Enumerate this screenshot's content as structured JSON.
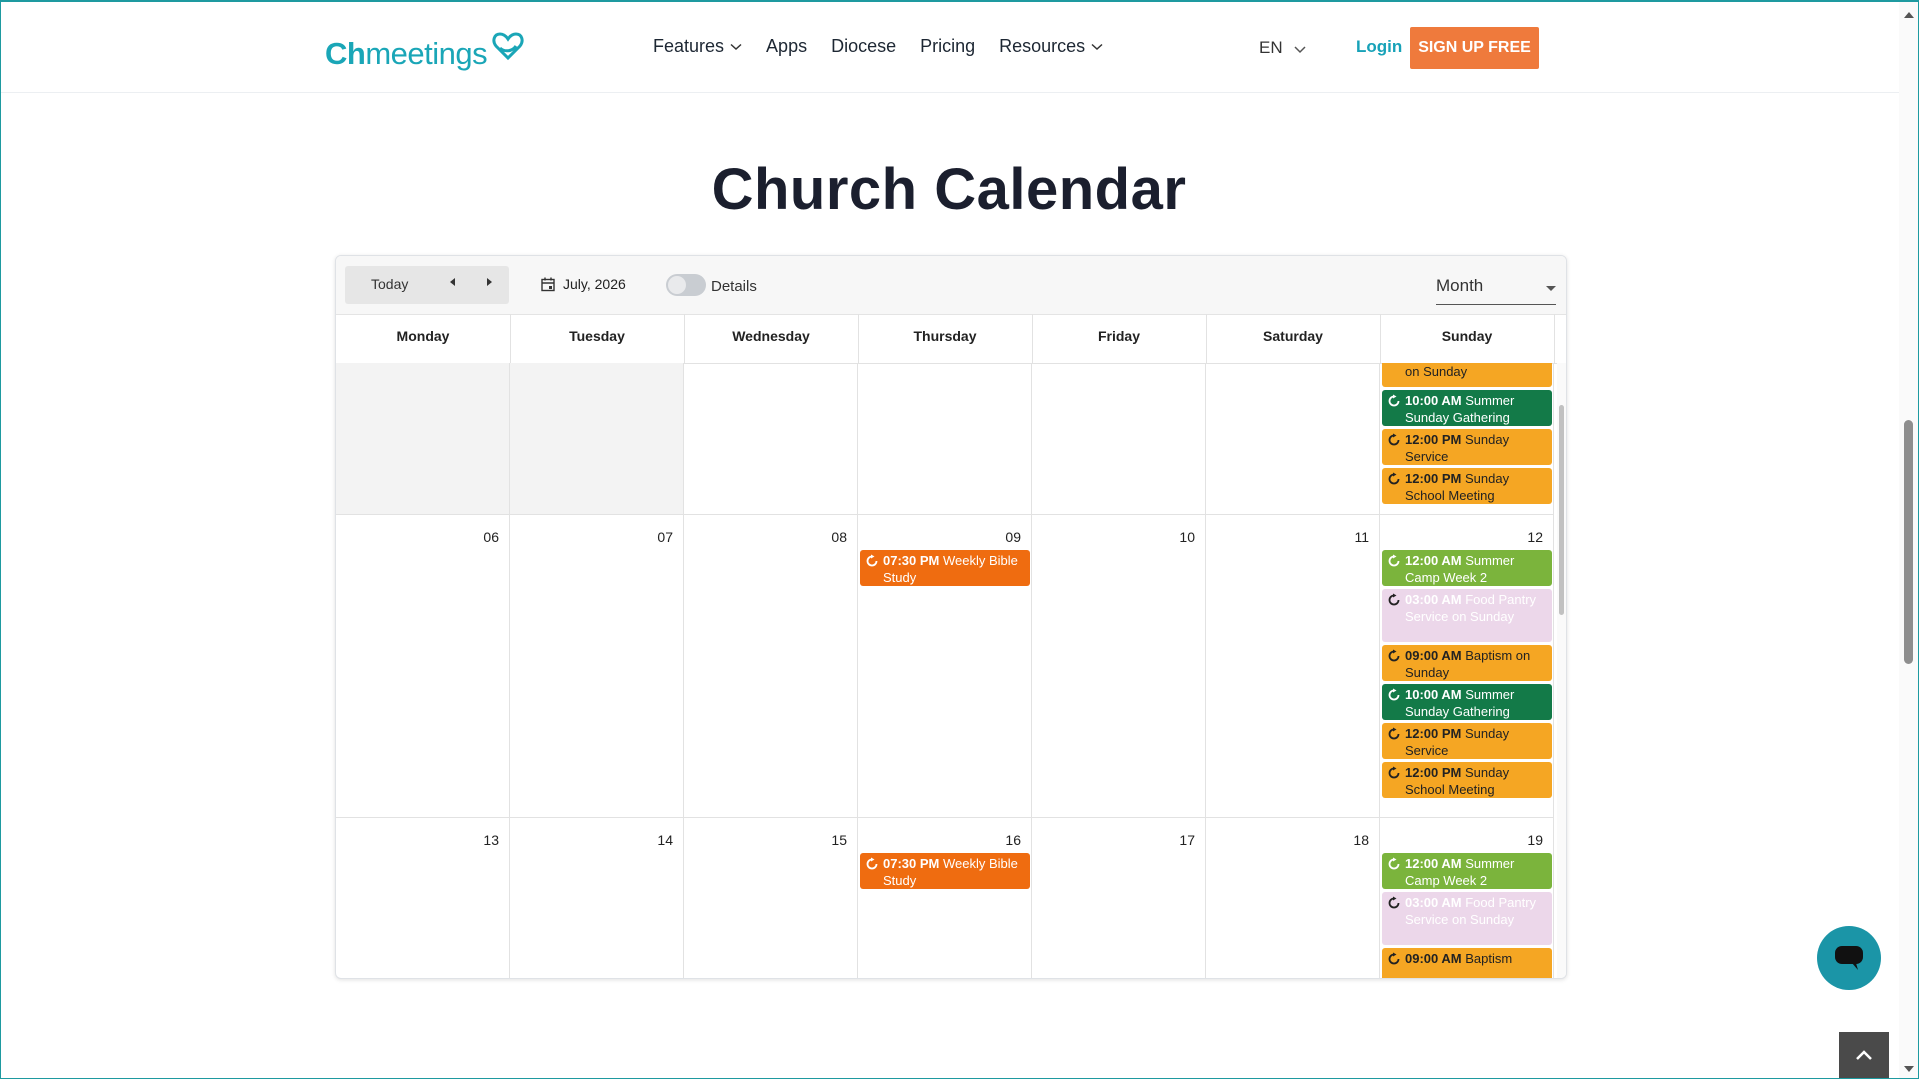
{
  "header": {
    "logo_bold": "Ch",
    "logo_rest": "meetings",
    "nav": [
      {
        "label": "Features",
        "dropdown": true
      },
      {
        "label": "Apps",
        "dropdown": false
      },
      {
        "label": "Diocese",
        "dropdown": false
      },
      {
        "label": "Pricing",
        "dropdown": false
      },
      {
        "label": "Resources",
        "dropdown": true
      }
    ],
    "language": "EN",
    "login_label": "Login",
    "signup_label": "SIGN UP FREE"
  },
  "page_title": "Church Calendar",
  "toolbar": {
    "today_label": "Today",
    "current_month": "July, 2026",
    "details_label": "Details",
    "details_enabled": false,
    "view_label": "Month"
  },
  "weekdays": [
    "Monday",
    "Tuesday",
    "Wednesday",
    "Thursday",
    "Friday",
    "Saturday",
    "Sunday"
  ],
  "weeks": [
    {
      "days": [
        {
          "date": "",
          "gray": true,
          "events": []
        },
        {
          "date": "",
          "gray": true,
          "events": []
        },
        {
          "date": "",
          "gray": false,
          "events": []
        },
        {
          "date": "",
          "gray": false,
          "events": []
        },
        {
          "date": "",
          "gray": false,
          "events": []
        },
        {
          "date": "",
          "gray": false,
          "events": []
        },
        {
          "date": "",
          "gray": false,
          "events": [
            {
              "time": "",
              "title": "on Sunday",
              "color": "orange",
              "partial": true
            },
            {
              "time": "10:00 AM",
              "title": "Summer Sunday Gathering",
              "color": "dgreen"
            },
            {
              "time": "12:00 PM",
              "title": "Sunday Service",
              "color": "orange"
            },
            {
              "time": "12:00 PM",
              "title": "Sunday School Meeting",
              "color": "orange"
            }
          ]
        }
      ]
    },
    {
      "days": [
        {
          "date": "06",
          "events": []
        },
        {
          "date": "07",
          "events": []
        },
        {
          "date": "08",
          "events": []
        },
        {
          "date": "09",
          "events": [
            {
              "time": "07:30 PM",
              "title": "Weekly Bible Study",
              "color": "dorange"
            }
          ]
        },
        {
          "date": "10",
          "events": []
        },
        {
          "date": "11",
          "events": []
        },
        {
          "date": "12",
          "events": [
            {
              "time": "12:00 AM",
              "title": "Summer Camp Week 2",
              "color": "lgreen"
            },
            {
              "time": "03:00 AM",
              "title": "Food Pantry Service on Sunday",
              "color": "pink"
            },
            {
              "time": "09:00 AM",
              "title": "Baptism on Sunday",
              "color": "orange"
            },
            {
              "time": "10:00 AM",
              "title": "Summer Sunday Gathering",
              "color": "dgreen"
            },
            {
              "time": "12:00 PM",
              "title": "Sunday Service",
              "color": "orange"
            },
            {
              "time": "12:00 PM",
              "title": "Sunday School Meeting",
              "color": "orange"
            }
          ]
        }
      ]
    },
    {
      "days": [
        {
          "date": "13",
          "events": []
        },
        {
          "date": "14",
          "events": []
        },
        {
          "date": "15",
          "events": []
        },
        {
          "date": "16",
          "events": [
            {
              "time": "07:30 PM",
              "title": "Weekly Bible Study",
              "color": "dorange"
            }
          ]
        },
        {
          "date": "17",
          "events": []
        },
        {
          "date": "18",
          "events": []
        },
        {
          "date": "19",
          "events": [
            {
              "time": "12:00 AM",
              "title": "Summer Camp Week 2",
              "color": "lgreen"
            },
            {
              "time": "03:00 AM",
              "title": "Food Pantry Service on Sunday",
              "color": "pink"
            },
            {
              "time": "09:00 AM",
              "title": "Baptism",
              "color": "orange"
            }
          ]
        }
      ]
    }
  ],
  "colors": {
    "brand": "#1aa6b7",
    "signup": "#ef7a3c",
    "orange": "#f5a623",
    "dgreen": "#137a48",
    "lgreen": "#7bb43c",
    "pink": "#ecd7ea",
    "dorange": "#ef6c10"
  },
  "icons": {
    "chat": "chat-bubble-icon",
    "back_to_top": "chevron-up-icon",
    "recurring": "recurring-icon",
    "calendar": "calendar-icon"
  }
}
